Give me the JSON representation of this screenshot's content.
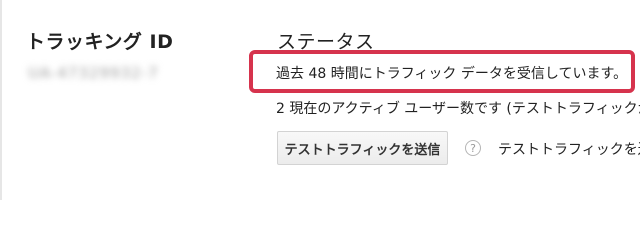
{
  "tracking": {
    "label": "トラッキング ID",
    "id_value": "UA-47329932-7"
  },
  "status": {
    "header": "ステータス",
    "message": "過去 48 時間にトラフィック データを受信しています。",
    "active_users": "2 現在のアクティブ ユーザー数です (テストトラフィックか"
  },
  "test_traffic": {
    "button_label": "テストトラフィックを送信",
    "help_icon_glyph": "?",
    "help_text": "テストトラフィックを送"
  },
  "colors": {
    "highlight_border": "#d6334d"
  }
}
